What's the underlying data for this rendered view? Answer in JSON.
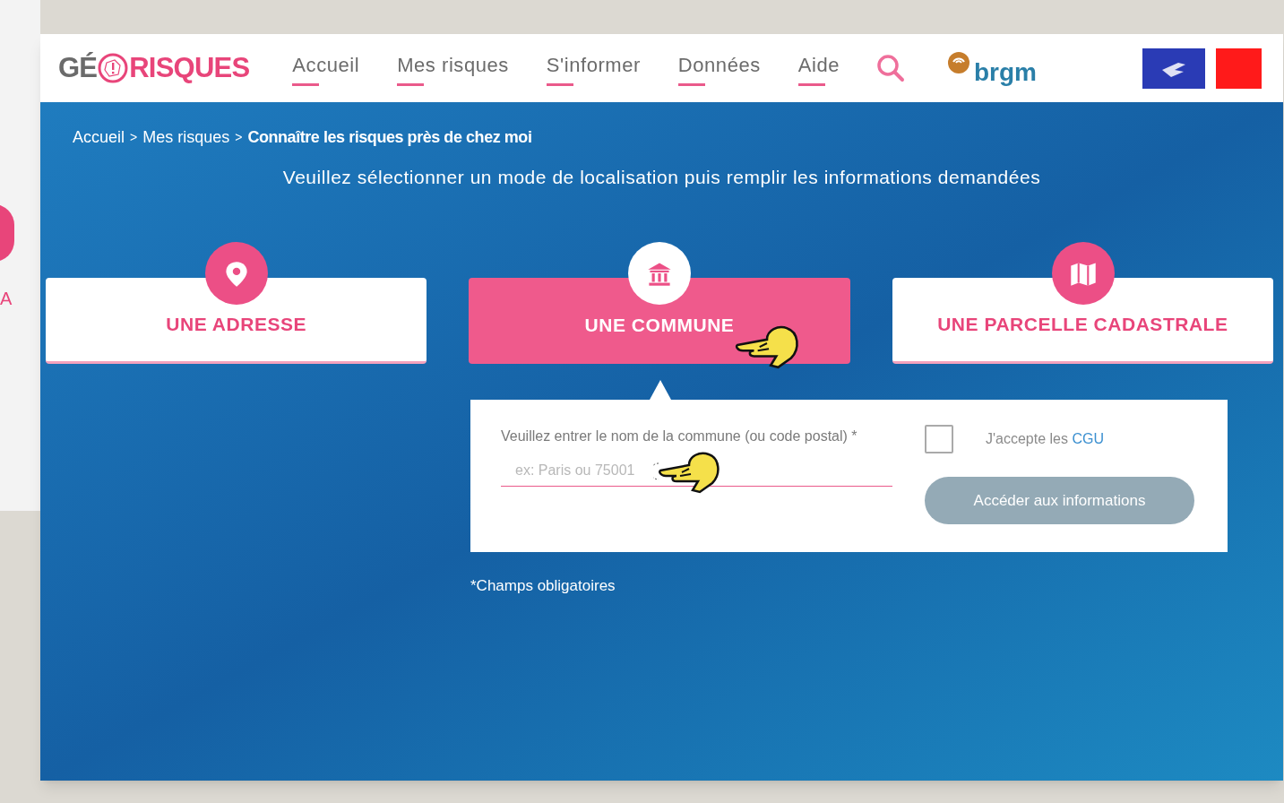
{
  "background_window": {
    "text": "A"
  },
  "header": {
    "logo": {
      "left": "GÉ",
      "right": "RISQUES"
    },
    "nav": [
      {
        "label": "Accueil"
      },
      {
        "label": "Mes risques"
      },
      {
        "label": "S'informer"
      },
      {
        "label": "Données"
      },
      {
        "label": "Aide"
      }
    ],
    "partner": {
      "name": "brgm"
    }
  },
  "breadcrumb": [
    {
      "label": "Accueil",
      "current": false
    },
    {
      "separator": ">",
      "label": "Mes risques",
      "current": false
    },
    {
      "separator": ">",
      "label": "Connaître les risques près de chez moi",
      "current": true
    }
  ],
  "instruction": "Veuillez sélectionner un mode de localisation puis remplir les informations demandées",
  "modes": [
    {
      "kind": "address",
      "label": "UNE ADRESSE",
      "selected": false
    },
    {
      "kind": "commune",
      "label": "UNE COMMUNE",
      "selected": true
    },
    {
      "kind": "parcel",
      "label": "UNE PARCELLE CADASTRALE",
      "selected": false
    }
  ],
  "form": {
    "field_label": "Veuillez entrer le nom de la commune (ou code postal) *",
    "placeholder": "ex: Paris ou 75001",
    "terms": {
      "text": "J'accepte les",
      "link": "CGU",
      "checked": false
    },
    "submit": {
      "label": "Accéder aux informations",
      "disabled": true
    }
  },
  "footnote": "*Champs obligatoires"
}
